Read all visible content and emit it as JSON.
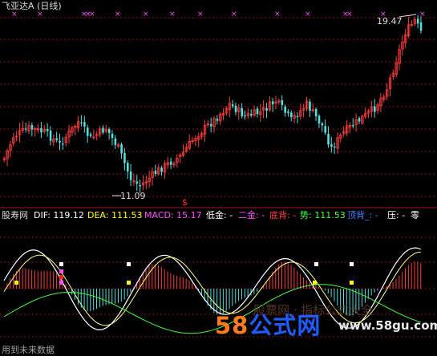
{
  "header": {
    "title": "飞亚达A (日线)"
  },
  "price_labels": {
    "high": "19.47",
    "low": "11.09"
  },
  "signal_marker": "$",
  "indicator_bar": {
    "name": "股寿网",
    "dif": "DIF: 119.12",
    "dea": "DEA: 111.53",
    "macd": "MACD: 15.17",
    "low_gold": "低金: -",
    "second_gold": "二金: -",
    "bottom_div": "底背: -",
    "trend": "势: 111.53",
    "top_div": "顶背_: -",
    "pressure": "压: -",
    "zero": "零"
  },
  "watermark": {
    "faint_text": "股票网 · 指标公式大全",
    "brand_number": "58",
    "brand_text": "公式网",
    "url": "www.58gu.com"
  },
  "bottom_note": "用到未来数据",
  "colors": {
    "background": "#000000",
    "up": "#ff3c3c",
    "down": "#4fe0e0",
    "grid": "#8b1010",
    "title": "#dcdcdc",
    "dif": "#ffffff",
    "dea": "#ffff00",
    "macd": "#ff50ff",
    "low_gold": "#ffffff",
    "second_gold": "#ff50ff",
    "bottom_div": "#ff4040",
    "trend": "#40ff40",
    "top_div": "#4080ff",
    "pressure": "#ffffff",
    "marker": "#ff50ff",
    "signal": "#ff3030"
  }
}
